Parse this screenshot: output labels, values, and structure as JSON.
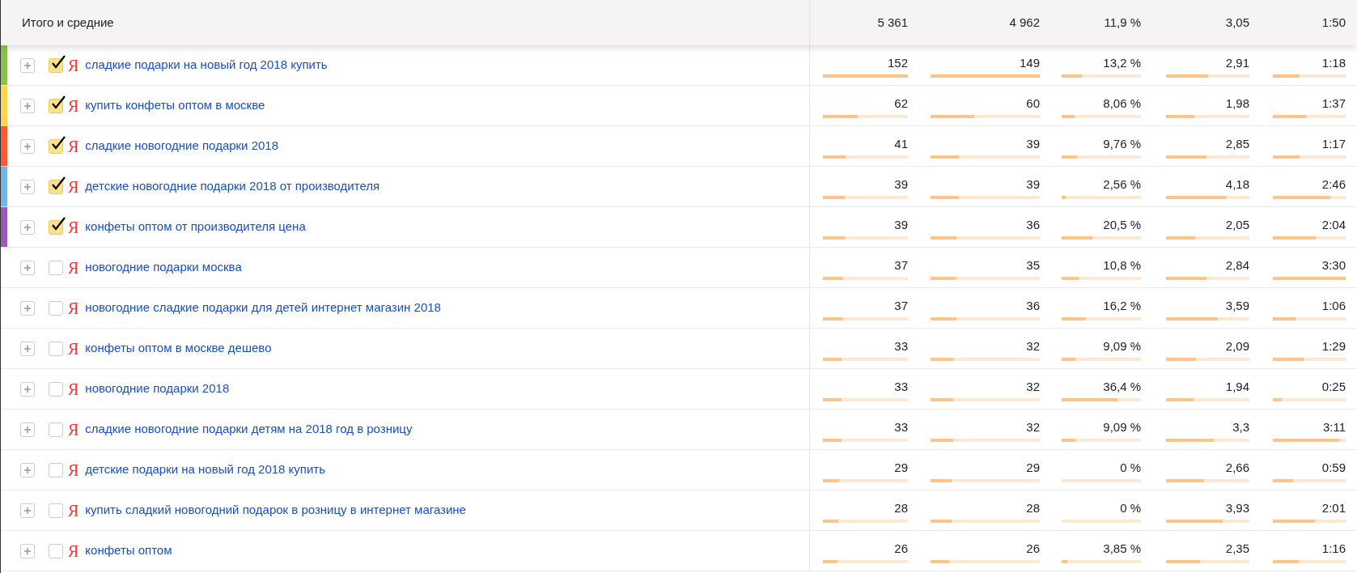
{
  "totals": {
    "label": "Итого и средние",
    "values": [
      "5 361",
      "4 962",
      "11,9 %",
      "3,05",
      "1:50"
    ]
  },
  "rows": [
    {
      "checked": true,
      "color": "#8bc34a",
      "mark": "Я",
      "query": "сладкие подарки на новый год 2018 купить",
      "cells": [
        {
          "value": "152",
          "level": 1
        },
        {
          "value": "149",
          "level": 1
        },
        {
          "value": "13,2 %",
          "level": 0.25
        },
        {
          "value": "2,91",
          "level": 0.5
        },
        {
          "value": "1:18",
          "level": 0.37
        }
      ]
    },
    {
      "checked": true,
      "color": "#ffd54f",
      "mark": "Я",
      "query": "купить конфеты оптом в москве",
      "cells": [
        {
          "value": "62",
          "level": 0.41
        },
        {
          "value": "60",
          "level": 0.4
        },
        {
          "value": "8,06 %",
          "level": 0.16
        },
        {
          "value": "1,98",
          "level": 0.34
        },
        {
          "value": "1:37",
          "level": 0.46
        }
      ]
    },
    {
      "checked": true,
      "color": "#ff5a36",
      "mark": "Я",
      "query": "сладкие новогодние подарки 2018",
      "cells": [
        {
          "value": "41",
          "level": 0.27
        },
        {
          "value": "39",
          "level": 0.26
        },
        {
          "value": "9,76 %",
          "level": 0.19
        },
        {
          "value": "2,85",
          "level": 0.49
        },
        {
          "value": "1:17",
          "level": 0.37
        }
      ]
    },
    {
      "checked": true,
      "color": "#74b4e6",
      "mark": "Я",
      "query": "детские новогодние подарки 2018 от производителя",
      "cells": [
        {
          "value": "39",
          "level": 0.26
        },
        {
          "value": "39",
          "level": 0.26
        },
        {
          "value": "2,56 %",
          "level": 0.05
        },
        {
          "value": "4,18",
          "level": 0.72
        },
        {
          "value": "2:46",
          "level": 0.79
        }
      ]
    },
    {
      "checked": true,
      "color": "#9b59b6",
      "mark": "Я",
      "query": "конфеты оптом от производителя цена",
      "cells": [
        {
          "value": "39",
          "level": 0.26
        },
        {
          "value": "36",
          "level": 0.24
        },
        {
          "value": "20,5 %",
          "level": 0.39
        },
        {
          "value": "2,05",
          "level": 0.35
        },
        {
          "value": "2:04",
          "level": 0.59
        }
      ]
    },
    {
      "checked": false,
      "mark": "Я",
      "query": "новогодние подарки москва",
      "cells": [
        {
          "value": "37",
          "level": 0.24
        },
        {
          "value": "35",
          "level": 0.23
        },
        {
          "value": "10,8 %",
          "level": 0.21
        },
        {
          "value": "2,84",
          "level": 0.49
        },
        {
          "value": "3:30",
          "level": 1
        }
      ]
    },
    {
      "checked": false,
      "mark": "Я",
      "query": "новогодние сладкие подарки для детей интернет магазин 2018",
      "cells": [
        {
          "value": "37",
          "level": 0.24
        },
        {
          "value": "36",
          "level": 0.24
        },
        {
          "value": "16,2 %",
          "level": 0.31
        },
        {
          "value": "3,59",
          "level": 0.62
        },
        {
          "value": "1:06",
          "level": 0.31
        }
      ]
    },
    {
      "checked": false,
      "mark": "Я",
      "query": "конфеты оптом в москве дешево",
      "cells": [
        {
          "value": "33",
          "level": 0.22
        },
        {
          "value": "32",
          "level": 0.21
        },
        {
          "value": "9,09 %",
          "level": 0.17
        },
        {
          "value": "2,09",
          "level": 0.36
        },
        {
          "value": "1:29",
          "level": 0.42
        }
      ]
    },
    {
      "checked": false,
      "mark": "Я",
      "query": "новогодние подарки 2018",
      "cells": [
        {
          "value": "33",
          "level": 0.22
        },
        {
          "value": "32",
          "level": 0.21
        },
        {
          "value": "36,4 %",
          "level": 0.7
        },
        {
          "value": "1,94",
          "level": 0.33
        },
        {
          "value": "0:25",
          "level": 0.12
        }
      ]
    },
    {
      "checked": false,
      "mark": "Я",
      "query": "сладкие новогодние подарки детям на 2018 год в розницу",
      "cells": [
        {
          "value": "33",
          "level": 0.22
        },
        {
          "value": "32",
          "level": 0.21
        },
        {
          "value": "9,09 %",
          "level": 0.17
        },
        {
          "value": "3,3",
          "level": 0.57
        },
        {
          "value": "3:11",
          "level": 0.91
        }
      ]
    },
    {
      "checked": false,
      "mark": "Я",
      "query": "детские подарки на новый год 2018 купить",
      "cells": [
        {
          "value": "29",
          "level": 0.19
        },
        {
          "value": "29",
          "level": 0.19
        },
        {
          "value": "0 %",
          "level": 0
        },
        {
          "value": "2,66",
          "level": 0.46
        },
        {
          "value": "0:59",
          "level": 0.28
        }
      ]
    },
    {
      "checked": false,
      "mark": "Я",
      "query": "купить сладкий новогодний подарок в розницу в интернет магазине",
      "cells": [
        {
          "value": "28",
          "level": 0.18
        },
        {
          "value": "28",
          "level": 0.19
        },
        {
          "value": "0 %",
          "level": 0
        },
        {
          "value": "3,93",
          "level": 0.68
        },
        {
          "value": "2:01",
          "level": 0.58
        }
      ]
    },
    {
      "checked": false,
      "mark": "Я",
      "query": "конфеты оптом",
      "cells": [
        {
          "value": "26",
          "level": 0.17
        },
        {
          "value": "26",
          "level": 0.17
        },
        {
          "value": "3,85 %",
          "level": 0.07
        },
        {
          "value": "2,35",
          "level": 0.41
        },
        {
          "value": "1:16",
          "level": 0.36
        }
      ]
    }
  ]
}
